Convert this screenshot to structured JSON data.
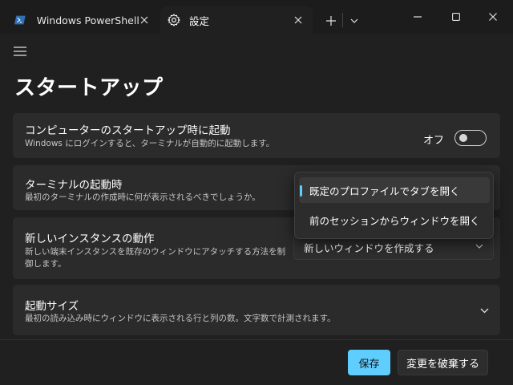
{
  "titlebar": {
    "tabs": [
      {
        "label": "Windows PowerShell",
        "icon": "powershell-icon"
      },
      {
        "label": "設定",
        "icon": "gear-icon"
      }
    ],
    "new_tab_icon": "plus-icon",
    "dropdown_icon": "chevron-down-icon",
    "window_controls": [
      "minimize-icon",
      "maximize-icon",
      "close-icon"
    ]
  },
  "page": {
    "title": "スタートアップ"
  },
  "settings": {
    "launch_on_startup": {
      "title": "コンピューターのスタートアップ時に起動",
      "description": "Windows にログインすると、ターミナルが自動的に起動します。",
      "toggle_label": "オフ",
      "toggle_on": false
    },
    "launch_mode": {
      "title": "ターミナルの起動時",
      "description": "最初のターミナルの作成時に何が表示されるべきでしょうか。",
      "options": [
        "既定のプロファイルでタブを開く",
        "前のセッションからウィンドウを開く"
      ],
      "selected_index": 0
    },
    "new_instance": {
      "title": "新しいインスタンスの動作",
      "description_line1": "新しい端末インスタンスを既存のウィンドウにアタッチする方法を制",
      "description_line2": "御します。",
      "value": "新しいウィンドウを作成する"
    },
    "launch_size": {
      "title": "起動サイズ",
      "description": "最初の読み込み時にウィンドウに表示される行と列の数。文字数で計測されます。"
    }
  },
  "footer": {
    "save_label": "保存",
    "discard_label": "変更を破棄する"
  },
  "colors": {
    "accent": "#60cdff",
    "background": "#202020",
    "card": "#2b2b2b",
    "titlebar": "#1c1c1c"
  }
}
